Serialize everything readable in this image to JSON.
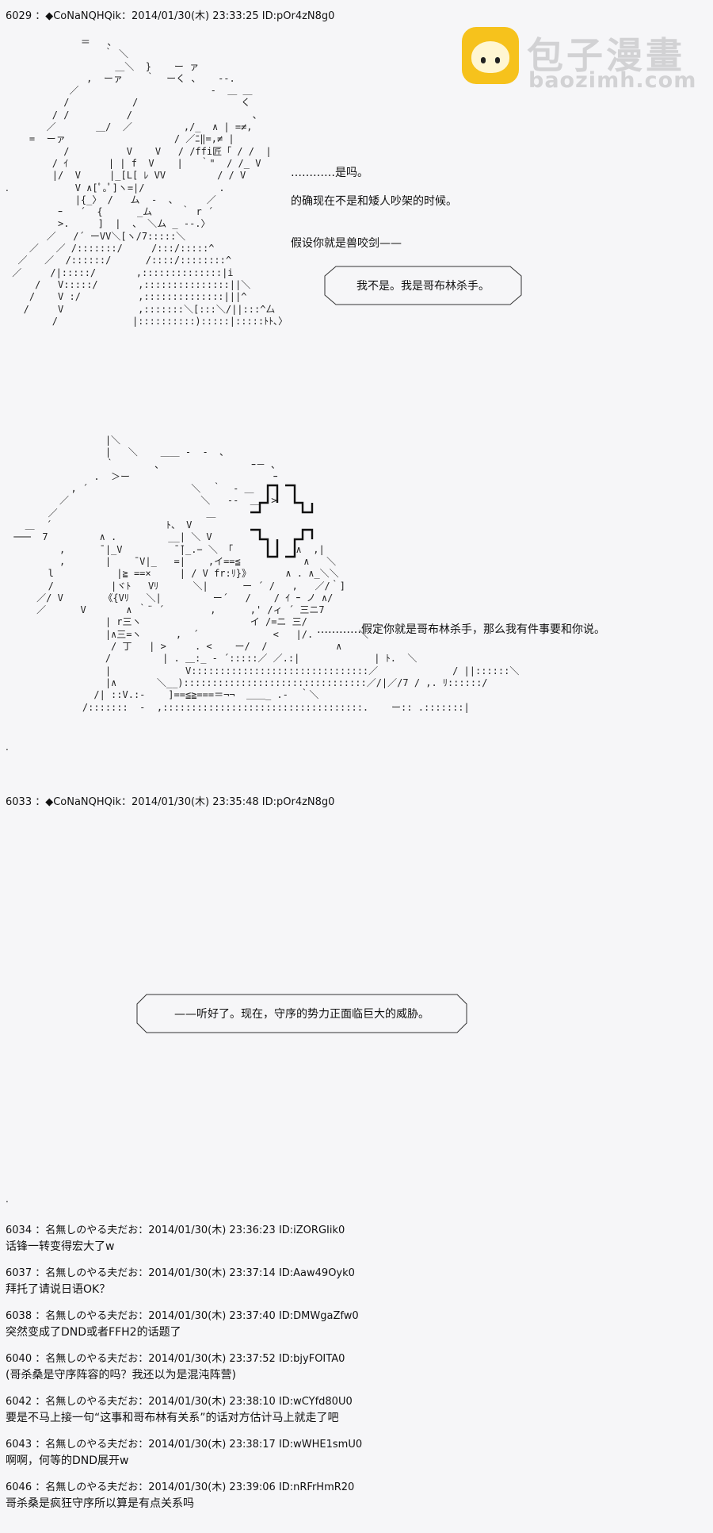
{
  "watermark": {
    "title": "包子漫畫",
    "url": "baozimh.com"
  },
  "posts": [
    {
      "header": "6029 ：◆CoNaNQHQik：2014/01/30(木) 23:33:25 ID:pOr4zN8g0"
    },
    {
      "header": "6033 ：◆CoNaNQHQik：2014/01/30(木) 23:35:48 ID:pOr4zN8g0"
    }
  ],
  "dialogue": {
    "line1": "…………是吗。",
    "line2": "的确现在不是和矮人吵架的时候。",
    "line3": "假设你就是兽咬剑——",
    "bubble1": "我不是。我是哥布林杀手。",
    "line4": "…………假定你就是哥布林杀手，那么我有件事要和你说。",
    "bubble2": "——听好了。现在，守序的势力正面临巨大的威胁。"
  },
  "replies": [
    {
      "header": "6034 ：名無しのやる夫だお：2014/01/30(木) 23:36:23 ID:iZORGIik0",
      "body": "话锋一转变得宏大了w"
    },
    {
      "header": "6037 ：名無しのやる夫だお：2014/01/30(木) 23:37:14 ID:Aaw49Oyk0",
      "body": "拜托了请说日语OK？"
    },
    {
      "header": "6038 ：名無しのやる夫だお：2014/01/30(木) 23:37:40 ID:DMWgaZfw0",
      "body": "突然变成了DND或者FFH2的话题了"
    },
    {
      "header": "6040 ：名無しのやる夫だお：2014/01/30(木) 23:37:52 ID:bjyFOITA0",
      "body": "(哥杀桑是守序阵容的吗？我还以为是混沌阵营)"
    },
    {
      "header": "6042 ：名無しのやる夫だお：2014/01/30(木) 23:38:10 ID:wCYfd80U0",
      "body": "要是不马上接一句“这事和哥布林有关系”的话对方估计马上就走了吧"
    },
    {
      "header": "6043 ：名無しのやる夫だお：2014/01/30(木) 23:38:17 ID:wWHE1smU0",
      "body": "啊啊，何等的DND展开w"
    },
    {
      "header": "6046 ：名無しのやる夫だお：2014/01/30(木) 23:39:06 ID:nRFrHmR20",
      "body": "哥杀桑是疯狂守序所以算是有点关系吗"
    }
  ]
}
